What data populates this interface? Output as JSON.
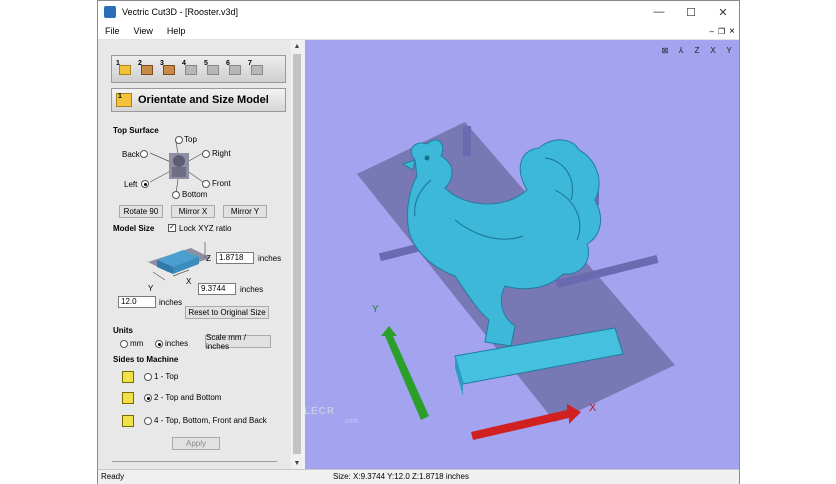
{
  "window": {
    "title": "Vectric Cut3D - [Rooster.v3d]",
    "controls": {
      "minimize": "—",
      "maximize": "☐",
      "close": "✕"
    }
  },
  "menu": {
    "items": [
      "File",
      "View",
      "Help"
    ],
    "right_controls": {
      "minimize": "–",
      "restore": "❐",
      "close": "×"
    }
  },
  "toolbar": {
    "buttons": [
      "1",
      "2",
      "3",
      "4",
      "5",
      "6",
      "7"
    ]
  },
  "section": {
    "number": "1",
    "title": "Orientate and Size Model"
  },
  "top_surface": {
    "heading": "Top Surface",
    "options": {
      "top": "Top",
      "back": "Back",
      "right": "Right",
      "left": "Left",
      "front": "Front",
      "bottom": "Bottom"
    },
    "selected": "left",
    "buttons": {
      "rotate": "Rotate 90",
      "mirror_x": "Mirror X",
      "mirror_y": "Mirror Y"
    }
  },
  "model_size": {
    "heading": "Model Size",
    "lock_label": "Lock XYZ ratio",
    "lock_checked": true,
    "z_value": "1.8718",
    "z_unit": "inches",
    "x_value": "9.3744",
    "x_unit": "inches",
    "y_value": "12.0",
    "y_unit": "inches",
    "axis_labels": {
      "z": "Z",
      "x": "X",
      "y": "Y"
    },
    "reset_button": "Reset to Original Size"
  },
  "units": {
    "heading": "Units",
    "mm": "mm",
    "inches": "inches",
    "selected": "inches",
    "scale_button": "Scale mm / inches"
  },
  "sides": {
    "heading": "Sides to Machine",
    "options": [
      "1 - Top",
      "2 - Top and Bottom",
      "4 - Top, Bottom, Front and Back"
    ],
    "selected_index": 1
  },
  "apply_button": "Apply",
  "viewport": {
    "background": "#a3a3f0",
    "model_color": "#3db8d8",
    "axis_x": "X",
    "axis_y": "Y",
    "view_icons": [
      "fit-view-icon",
      "iso-view-icon",
      "z-view-icon",
      "x-view-icon",
      "y-view-icon"
    ],
    "view_icon_glyphs": [
      "⊠",
      "⅄",
      "Z",
      "X",
      "Y"
    ]
  },
  "watermark": {
    "text": "FILECR",
    "sub": ".com"
  },
  "status": {
    "left": "Ready",
    "size": "Size: X:9.3744 Y:12.0 Z:1.8718 inches"
  }
}
